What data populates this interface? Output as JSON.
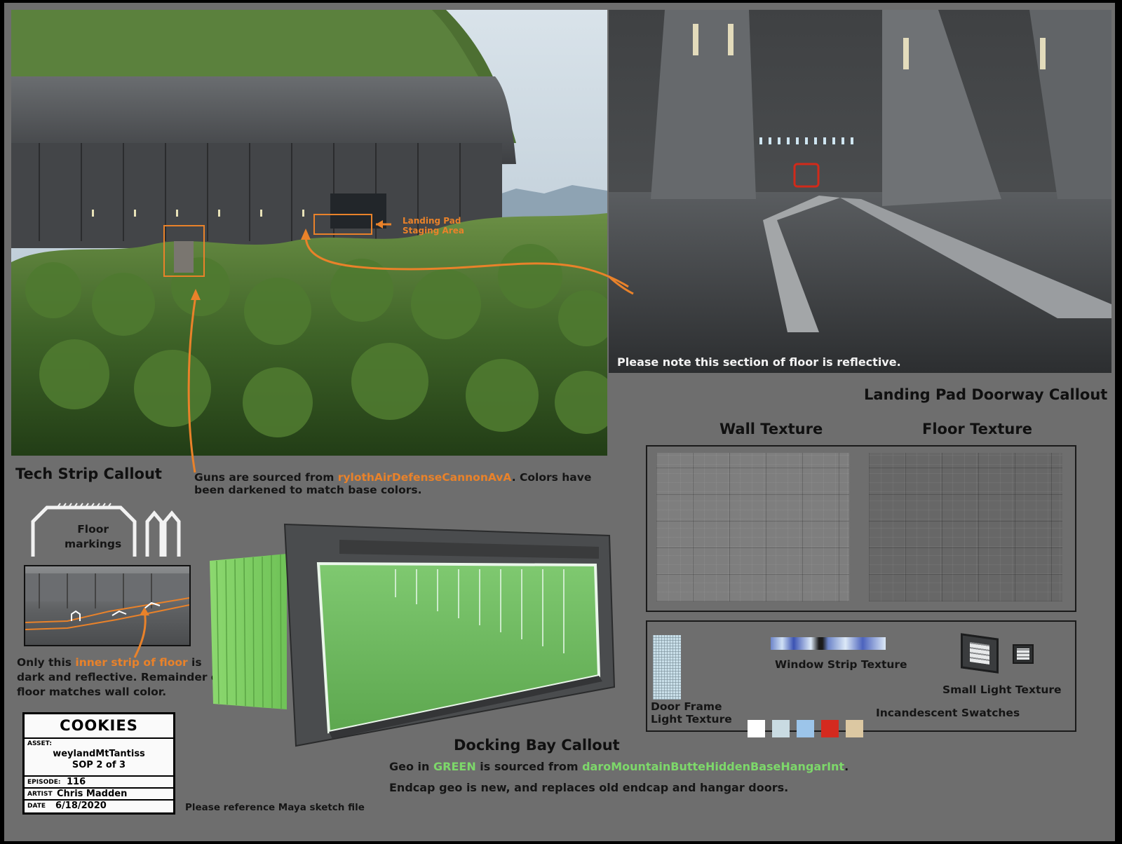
{
  "labels": {
    "landing_pad_staging": "Landing Pad\nStaging Area",
    "reflective_floor_note": "Please note this section of floor is reflective.",
    "landing_pad_doorway_callout": "Landing Pad Doorway Callout",
    "wall_texture": "Wall Texture",
    "floor_texture": "Floor Texture",
    "tech_strip_callout": "Tech Strip Callout",
    "floor_markings": "Floor\nmarkings",
    "guns_note": {
      "pre": "Guns are sourced from ",
      "asset": "rylothAirDefenseCannonAvA",
      "post": ". Colors have\nbeen darkened to match base colors."
    },
    "inner_strip_note": {
      "pre": "Only this ",
      "highlight": "inner strip of floor",
      "post": " is\ndark and reflective. Remainder of\nfloor matches wall color."
    },
    "window_strip_texture": "Window Strip Texture",
    "small_light_texture": "Small Light Texture",
    "door_frame_light_texture": "Door Frame\nLight Texture",
    "incandescent_swatches": "Incandescent Swatches",
    "docking_bay_callout": "Docking Bay Callout",
    "geo_note": {
      "pre": "Geo in ",
      "green_word": "GREEN",
      "mid": " is sourced from ",
      "asset": "daroMountainButteHiddenBaseHangarInt",
      "post": "."
    },
    "endcap_note": "Endcap geo is new, and replaces old endcap and hangar doors.",
    "maya_note": "Please reference Maya sketch file"
  },
  "card": {
    "logo": "COOKIES",
    "asset_label": "ASSET:",
    "asset_value": "weylandMtTantiss\nSOP 2 of 3",
    "episode_label": "EPISODE:",
    "episode_value": "116",
    "artist_label": "ARTIST",
    "artist_value": "Chris Madden",
    "date_label": "DATE",
    "date_value": "6/18/2020"
  },
  "colors": {
    "sheet_bg": "#6e6e6e",
    "callout_orange": "#e9822a",
    "geo_green": "#7dd86a",
    "swatches": [
      "#ffffff",
      "#c9dbe2",
      "#9cc5ea",
      "#d42a1f",
      "#dcc8a2"
    ]
  }
}
